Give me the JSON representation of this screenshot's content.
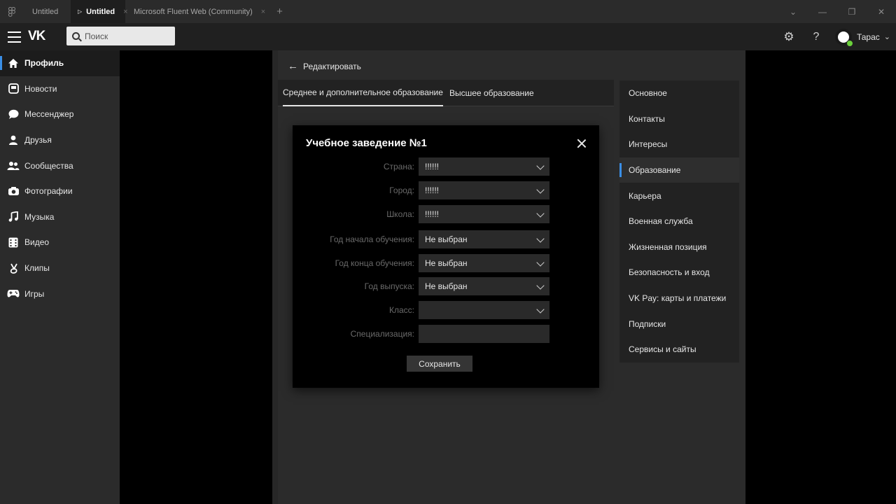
{
  "titlebar": {
    "tabs": [
      {
        "label": "Untitled",
        "active": false
      },
      {
        "label": "Untitled",
        "active": true
      },
      {
        "label": "Microsoft Fluent Web (Community)",
        "active": false
      }
    ],
    "add_label": "+",
    "close_glyph": "×"
  },
  "topbar": {
    "logo": "VK",
    "search": {
      "placeholder": "Поиск"
    },
    "user_name": "Тарас"
  },
  "sidebar": {
    "items": [
      {
        "label": "Профиль",
        "icon": "home-icon",
        "active": true
      },
      {
        "label": "Новости",
        "icon": "news-icon",
        "active": false
      },
      {
        "label": "Мессенджер",
        "icon": "chat-icon",
        "active": false
      },
      {
        "label": "Друзья",
        "icon": "person-icon",
        "active": false
      },
      {
        "label": "Сообщества",
        "icon": "people-icon",
        "active": false
      },
      {
        "label": "Фотографии",
        "icon": "camera-icon",
        "active": false
      },
      {
        "label": "Музыка",
        "icon": "music-icon",
        "active": false
      },
      {
        "label": "Видео",
        "icon": "film-icon",
        "active": false
      },
      {
        "label": "Клипы",
        "icon": "clips-icon",
        "active": false
      },
      {
        "label": "Игры",
        "icon": "gamepad-icon",
        "active": false
      }
    ]
  },
  "main": {
    "back_label": "Редактировать",
    "tabs": [
      {
        "label": "Среднее и дополнительное образование",
        "active": true
      },
      {
        "label": "Высшее образование",
        "active": false
      }
    ]
  },
  "settings_menu": {
    "items": [
      {
        "label": "Основное",
        "active": false
      },
      {
        "label": "Контакты",
        "active": false
      },
      {
        "label": "Интересы",
        "active": false
      },
      {
        "label": "Образование",
        "active": true
      },
      {
        "label": "Карьера",
        "active": false
      },
      {
        "label": "Военная служба",
        "active": false
      },
      {
        "label": "Жизненная позиция",
        "active": false
      },
      {
        "label": "Безопасность и вход",
        "active": false
      },
      {
        "label": "VK Pay: карты и платежи",
        "active": false
      },
      {
        "label": "Подписки",
        "active": false
      },
      {
        "label": "Сервисы и сайты",
        "active": false
      }
    ]
  },
  "modal": {
    "title": "Учебное заведение №1",
    "fields": [
      {
        "label": "Страна:",
        "value": "!!!!!!",
        "type": "select"
      },
      {
        "label": "Город:",
        "value": "!!!!!!",
        "type": "select"
      },
      {
        "label": "Школа:",
        "value": "!!!!!!",
        "type": "select"
      },
      {
        "label": "Год начала обучения:",
        "value": "Не выбран",
        "type": "select"
      },
      {
        "label": "Год конца обучения:",
        "value": "Не выбран",
        "type": "select"
      },
      {
        "label": "Год выпуска:",
        "value": "Не выбран",
        "type": "select"
      },
      {
        "label": "Класс:",
        "value": "",
        "type": "select"
      },
      {
        "label": "Специализация:",
        "value": "",
        "type": "input"
      }
    ],
    "save_label": "Сохранить"
  }
}
